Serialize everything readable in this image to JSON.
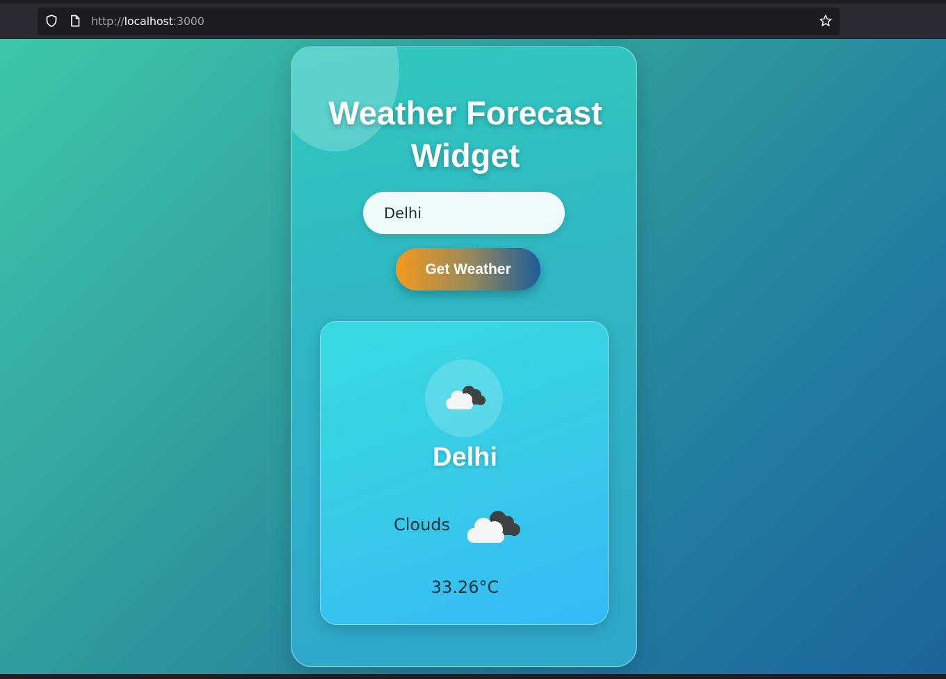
{
  "browser": {
    "url_scheme": "http://",
    "url_host": "localhost",
    "url_port": ":3000"
  },
  "app": {
    "title_line1": "Weather Forecast",
    "title_line2": "Widget",
    "search": {
      "value": "Delhi"
    },
    "button_label": "Get Weather"
  },
  "result": {
    "city": "Delhi",
    "condition": "Clouds",
    "temperature": "33.26°C",
    "icon": "cloud-icon"
  },
  "colors": {
    "button_start": "#f4991f",
    "button_end": "#1d5c9a",
    "card": "#30c8bd",
    "result_card": "#38dae0"
  }
}
